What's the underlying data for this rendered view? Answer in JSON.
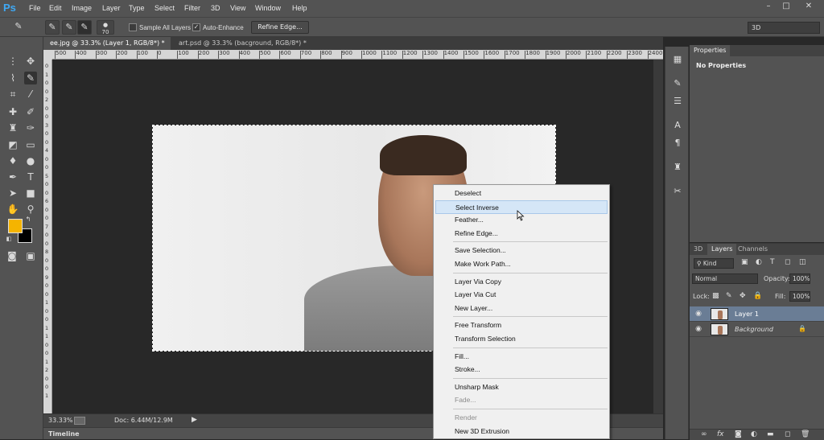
{
  "app": {
    "logo": "Ps",
    "menu": [
      "File",
      "Edit",
      "Image",
      "Layer",
      "Type",
      "Select",
      "Filter",
      "3D",
      "View",
      "Window",
      "Help"
    ],
    "window_controls": [
      "–",
      "□",
      "✕"
    ]
  },
  "options_bar": {
    "brush_size": "70",
    "sample_all_layers": "Sample All Layers",
    "auto_enhance": "Auto-Enhance",
    "refine_edge": "Refine Edge...",
    "workspace": "3D"
  },
  "doc_tabs": [
    {
      "label": "ee.jpg @ 33.3% (Layer 1, RGB/8*) *",
      "close": "×",
      "active": true
    },
    {
      "label": "art.psd @ 33.3% (bacground, RGB/8*) *",
      "close": "×",
      "active": false
    }
  ],
  "ruler_h": [
    "500",
    "400",
    "300",
    "200",
    "100",
    "0",
    "100",
    "200",
    "300",
    "400",
    "500",
    "600",
    "700",
    "800",
    "900",
    "1000",
    "1100",
    "1200",
    "1300",
    "1400",
    "1500",
    "1600",
    "1700",
    "1800",
    "1900",
    "2000",
    "2100",
    "2200",
    "2300",
    "2400"
  ],
  "ruler_v": [
    "0",
    "1",
    "0",
    "0",
    "2",
    "0",
    "0",
    "3",
    "0",
    "0",
    "4",
    "0",
    "0",
    "5",
    "0",
    "0",
    "6",
    "0",
    "0",
    "7",
    "0",
    "0",
    "8",
    "0",
    "0",
    "9",
    "0",
    "0",
    "1",
    "0",
    "0",
    "1",
    "1",
    "0",
    "0",
    "1",
    "2",
    "0",
    "0",
    "1"
  ],
  "status": {
    "zoom": "33.33%",
    "doc": "Doc: 6.44M/12.9M"
  },
  "timeline": "Timeline",
  "properties": {
    "tab": "Properties",
    "empty": "No Properties"
  },
  "layers_panel": {
    "tabs": [
      "3D",
      "Layers",
      "Channels"
    ],
    "kind": "Kind",
    "blend": "Normal",
    "opacity_label": "Opacity:",
    "opacity": "100%",
    "lock_label": "Lock:",
    "fill_label": "Fill:",
    "fill": "100%",
    "layers": [
      {
        "name": "Layer 1",
        "selected": true
      },
      {
        "name": "Background",
        "selected": false
      }
    ]
  },
  "context_menu": [
    {
      "label": "Deselect"
    },
    {
      "label": "Select Inverse",
      "highlight": true
    },
    {
      "label": "Feather..."
    },
    {
      "label": "Refine Edge..."
    },
    {
      "sep": true
    },
    {
      "label": "Save Selection..."
    },
    {
      "label": "Make Work Path..."
    },
    {
      "sep": true
    },
    {
      "label": "Layer Via Copy"
    },
    {
      "label": "Layer Via Cut"
    },
    {
      "label": "New Layer..."
    },
    {
      "sep": true
    },
    {
      "label": "Free Transform"
    },
    {
      "label": "Transform Selection"
    },
    {
      "sep": true
    },
    {
      "label": "Fill..."
    },
    {
      "label": "Stroke..."
    },
    {
      "sep": true
    },
    {
      "label": "Unsharp Mask"
    },
    {
      "label": "Fade...",
      "disabled": true
    },
    {
      "sep": true
    },
    {
      "label": "Render",
      "disabled": true
    },
    {
      "label": "New 3D Extrusion"
    }
  ],
  "colors": {
    "foreground": "#f5b400",
    "background": "#000000",
    "highlight": "#d5e6f7"
  }
}
